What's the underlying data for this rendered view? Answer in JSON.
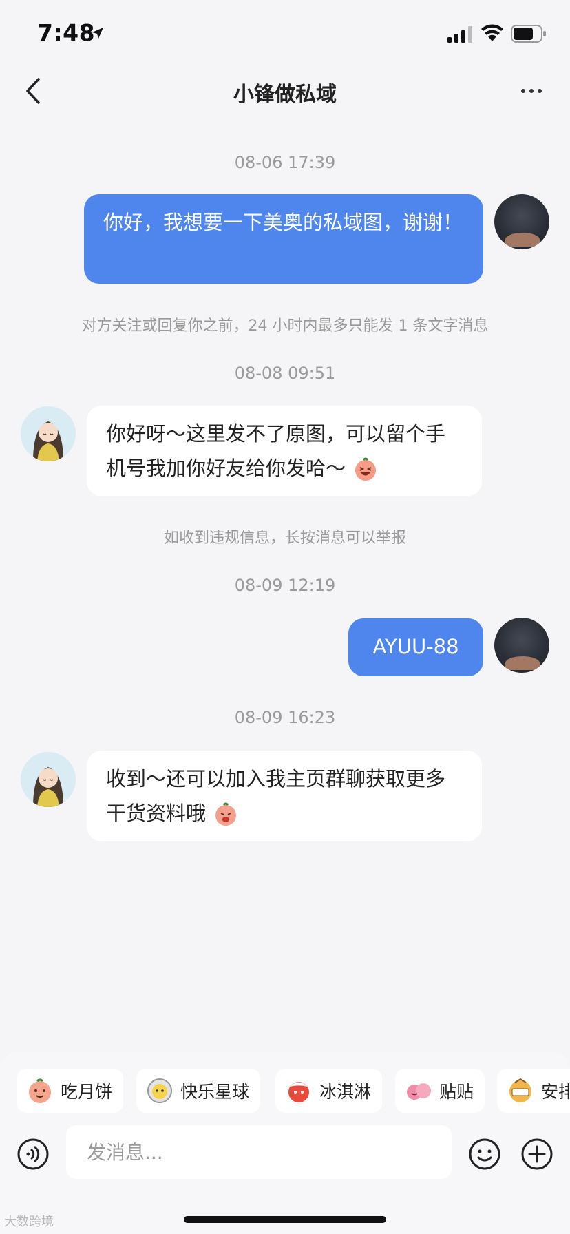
{
  "status_bar": {
    "time": "7:48"
  },
  "header": {
    "title": "小锋做私域"
  },
  "messages": {
    "ts1": "08-06 17:39",
    "msg1": "你好，我想要一下美奥的私域图，谢谢！",
    "notice1": "对方关注或回复你之前，24 小时内最多只能发 1 条文字消息",
    "ts2": "08-08 09:51",
    "msg2": "你好呀～这里发不了原图，可以留个手机号我加你好友给你发哈～",
    "notice2": "如收到违规信息，长按消息可以举报",
    "ts3": "08-09 12:19",
    "msg3": "AYUU-88",
    "ts4": "08-09 16:23",
    "msg4": "收到～还可以加入我主页群聊获取更多干货资料哦"
  },
  "stickers": [
    {
      "label": "吃月饼",
      "icon": "mooncake-sticker-icon"
    },
    {
      "label": "快乐星球",
      "icon": "astronaut-sticker-icon"
    },
    {
      "label": "冰淇淋",
      "icon": "icecream-sticker-icon"
    },
    {
      "label": "贴贴",
      "icon": "cuddle-sticker-icon"
    },
    {
      "label": "安排",
      "icon": "arrange-sticker-icon"
    }
  ],
  "input": {
    "placeholder": "发消息..."
  },
  "watermark": "大数跨境",
  "colors": {
    "accent": "#4e86ee",
    "background": "#f5f5f7",
    "bubble_in": "#ffffff"
  }
}
